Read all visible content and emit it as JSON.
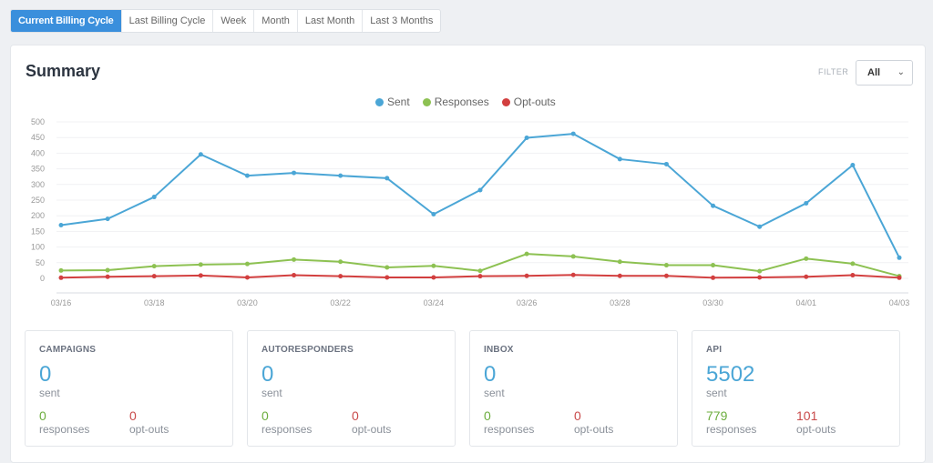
{
  "tabs": [
    {
      "label": "Current Billing Cycle",
      "active": true
    },
    {
      "label": "Last Billing Cycle",
      "active": false
    },
    {
      "label": "Week",
      "active": false
    },
    {
      "label": "Month",
      "active": false
    },
    {
      "label": "Last Month",
      "active": false
    },
    {
      "label": "Last 3 Months",
      "active": false
    }
  ],
  "summary": {
    "title": "Summary",
    "filter_label": "FILTER",
    "filter_value": "All",
    "filter_icon": "chevron-down-icon"
  },
  "colors": {
    "sent": "#4ba6d6",
    "responses": "#8dc152",
    "optouts": "#d23f3f",
    "accent": "#3a8fdc"
  },
  "chart_data": {
    "type": "line",
    "title": "",
    "xlabel": "",
    "ylabel": "",
    "ylim": [
      0,
      500
    ],
    "yticks": [
      0,
      50,
      100,
      150,
      200,
      250,
      300,
      350,
      400,
      450,
      500
    ],
    "grid": true,
    "legend_position": "top-center",
    "x": [
      "03/16",
      "03/17",
      "03/18",
      "03/19",
      "03/20",
      "03/21",
      "03/22",
      "03/23",
      "03/24",
      "03/25",
      "03/26",
      "03/27",
      "03/28",
      "03/29",
      "03/30",
      "03/31",
      "04/01",
      "04/02",
      "04/03"
    ],
    "xtick_labels": [
      "03/16",
      "03/18",
      "03/20",
      "03/22",
      "03/24",
      "03/26",
      "03/28",
      "03/30",
      "04/01",
      "04/03"
    ],
    "series": [
      {
        "name": "Sent",
        "color": "#4ba6d6",
        "values": [
          170,
          190,
          260,
          396,
          328,
          337,
          328,
          320,
          205,
          282,
          449,
          462,
          381,
          365,
          232,
          165,
          240,
          362,
          66
        ]
      },
      {
        "name": "Responses",
        "color": "#8dc152",
        "values": [
          25,
          26,
          39,
          44,
          46,
          60,
          53,
          35,
          40,
          24,
          78,
          70,
          53,
          42,
          42,
          23,
          63,
          47,
          7
        ]
      },
      {
        "name": "Opt-outs",
        "color": "#d23f3f",
        "values": [
          2,
          5,
          7,
          9,
          3,
          10,
          7,
          3,
          3,
          7,
          8,
          11,
          8,
          8,
          2,
          3,
          5,
          10,
          2
        ]
      }
    ]
  },
  "stats": [
    {
      "title": "CAMPAIGNS",
      "sent": "0",
      "sent_label": "sent",
      "responses": "0",
      "responses_label": "responses",
      "optouts": "0",
      "optouts_label": "opt-outs"
    },
    {
      "title": "AUTORESPONDERS",
      "sent": "0",
      "sent_label": "sent",
      "responses": "0",
      "responses_label": "responses",
      "optouts": "0",
      "optouts_label": "opt-outs"
    },
    {
      "title": "INBOX",
      "sent": "0",
      "sent_label": "sent",
      "responses": "0",
      "responses_label": "responses",
      "optouts": "0",
      "optouts_label": "opt-outs"
    },
    {
      "title": "API",
      "sent": "5502",
      "sent_label": "sent",
      "responses": "779",
      "responses_label": "responses",
      "optouts": "101",
      "optouts_label": "opt-outs"
    }
  ]
}
